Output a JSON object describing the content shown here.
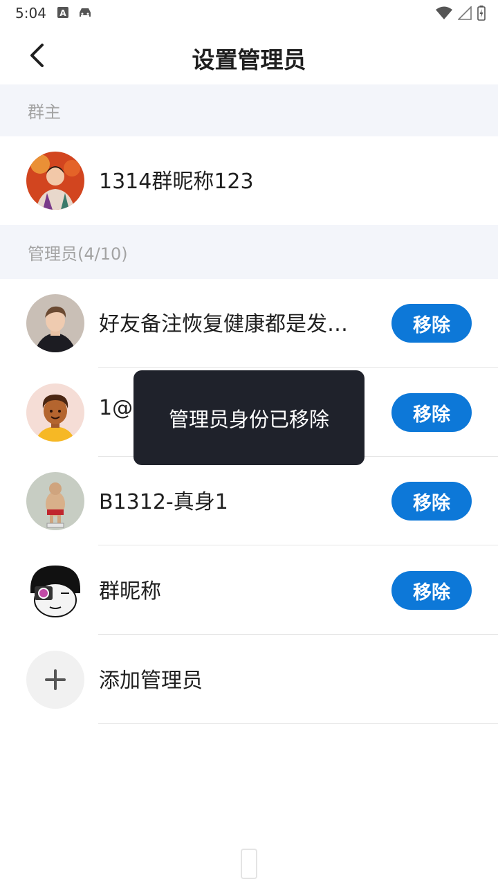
{
  "status_bar": {
    "time": "5:04",
    "left_icons": [
      "a-badge-icon",
      "car-icon"
    ],
    "right_icons": [
      "wifi-icon",
      "signal-icon",
      "battery-icon"
    ]
  },
  "header": {
    "title": "设置管理员",
    "back_icon": "chevron-left-icon"
  },
  "owner_section": {
    "label": "群主",
    "member": {
      "name": "1314群昵称123"
    }
  },
  "admin_section": {
    "label": "管理员(4/10)",
    "members": [
      {
        "name": "好友备注恢复健康都是发…",
        "action": "移除"
      },
      {
        "name": "1@c",
        "action": "移除"
      },
      {
        "name": "B1312-真身1",
        "action": "移除"
      },
      {
        "name": "群昵称",
        "action": "移除"
      }
    ],
    "add_label": "添加管理员"
  },
  "toast": {
    "message": "管理员身份已移除"
  },
  "colors": {
    "accent": "#0d78d8",
    "section_bg": "#f3f5fa",
    "toast_bg": "#1f222b"
  }
}
